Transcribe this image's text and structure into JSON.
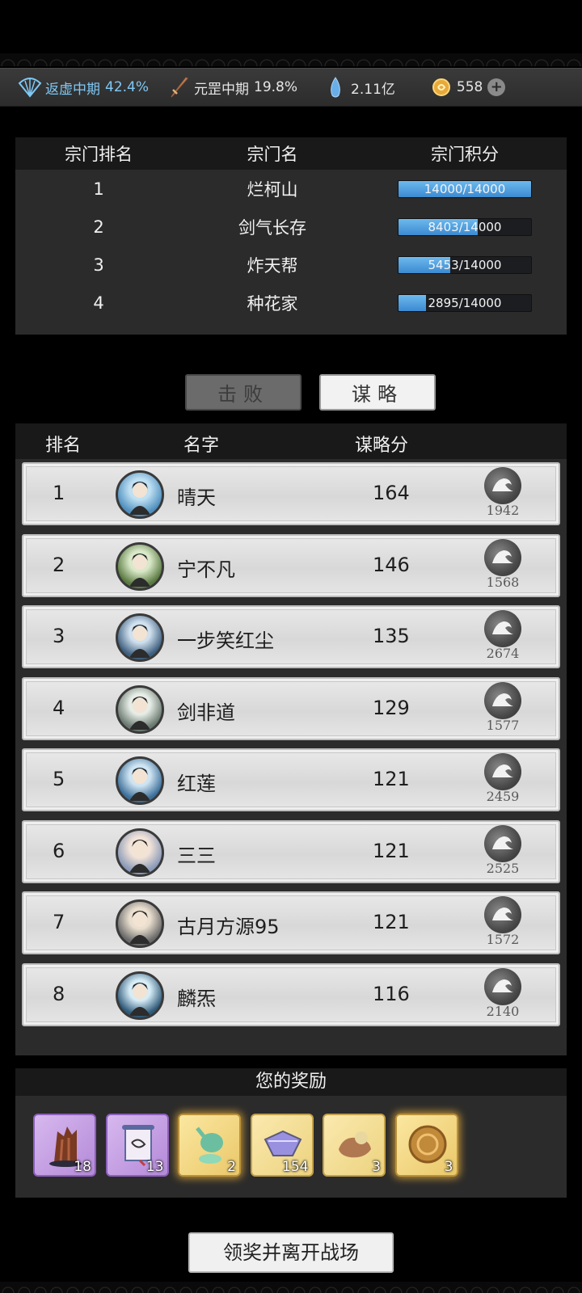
{
  "status_bar": {
    "stat1": {
      "label": "返虚中期",
      "value": "42.4%",
      "icon": "fan-icon"
    },
    "stat2": {
      "label": "元罡中期",
      "value": "19.8%",
      "icon": "sword-icon"
    },
    "stat3": {
      "value": "2.11亿",
      "icon": "spirit-crystal-icon"
    },
    "stat4": {
      "value": "558",
      "icon": "coin-icon"
    }
  },
  "sect_table": {
    "headers": {
      "rank": "宗门排名",
      "name": "宗门名",
      "score": "宗门积分"
    },
    "rows": [
      {
        "rank": "1",
        "name": "烂柯山",
        "score": "14000/14000",
        "progress": 1.0
      },
      {
        "rank": "2",
        "name": "剑气长存",
        "score": "8403/14000",
        "progress": 0.6
      },
      {
        "rank": "3",
        "name": "炸天帮",
        "score": "5453/14000",
        "progress": 0.39
      },
      {
        "rank": "4",
        "name": "种花家",
        "score": "2895/14000",
        "progress": 0.21
      }
    ]
  },
  "tabs": {
    "defeat": "击败",
    "strategy": "谋略"
  },
  "ranking": {
    "headers": {
      "rank": "排名",
      "name": "名字",
      "score": "谋略分"
    },
    "rows": [
      {
        "rank": "1",
        "name": "晴天",
        "score": "164",
        "power": "1942"
      },
      {
        "rank": "2",
        "name": "宁不凡",
        "score": "146",
        "power": "1568"
      },
      {
        "rank": "3",
        "name": "一步笑红尘",
        "score": "135",
        "power": "2674"
      },
      {
        "rank": "4",
        "name": "剑非道",
        "score": "129",
        "power": "1577"
      },
      {
        "rank": "5",
        "name": "红莲",
        "score": "121",
        "power": "2459"
      },
      {
        "rank": "6",
        "name": "三三",
        "score": "121",
        "power": "2525"
      },
      {
        "rank": "7",
        "name": "古月方源95",
        "score": "121",
        "power": "1572"
      },
      {
        "rank": "8",
        "name": "麟炁",
        "score": "116",
        "power": "2140"
      }
    ]
  },
  "rewards": {
    "title": "您的奖励",
    "items": [
      {
        "icon": "wood-stump-icon",
        "count": "18",
        "rarity": "purple"
      },
      {
        "icon": "scroll-icon",
        "count": "13",
        "rarity": "purple"
      },
      {
        "icon": "jade-vase-icon",
        "count": "2",
        "rarity": "gold"
      },
      {
        "icon": "spirit-stone-icon",
        "count": "154",
        "rarity": "yellow"
      },
      {
        "icon": "pouch-icon",
        "count": "3",
        "rarity": "yellow"
      },
      {
        "icon": "dragon-disc-icon",
        "count": "3",
        "rarity": "gold"
      }
    ]
  },
  "claim_button": "领奖并离开战场"
}
